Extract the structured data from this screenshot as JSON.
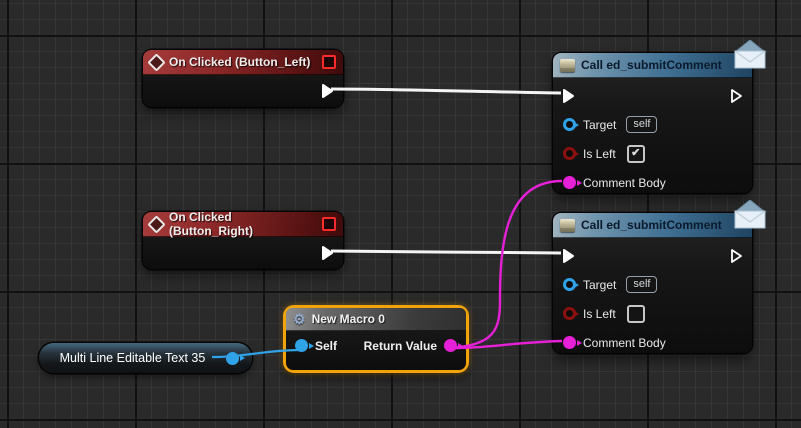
{
  "nodes": {
    "event_left": {
      "title": "On Clicked (Button_Left)"
    },
    "event_right": {
      "title": "On Clicked (Button_Right)"
    },
    "call_top": {
      "title": "Call ed_submitComment",
      "target_label": "Target",
      "target_value": "self",
      "is_left_label": "Is Left",
      "is_left_checked": true,
      "is_left_check_glyph": "✔",
      "comment_label": "Comment Body"
    },
    "call_bottom": {
      "title": "Call ed_submitComment",
      "target_label": "Target",
      "target_value": "self",
      "is_left_label": "Is Left",
      "is_left_checked": false,
      "is_left_check_glyph": "",
      "comment_label": "Comment Body"
    },
    "macro": {
      "title": "New Macro 0",
      "self_label": "Self",
      "return_label": "Return Value",
      "gear_glyph": "⚙"
    },
    "variable": {
      "title": "Multi Line Editable Text 35"
    }
  },
  "colors": {
    "exec_wire": "#f5f5f5",
    "data_wire_magenta": "#e620d6",
    "data_wire_blue": "#2fa2e8",
    "selection_border": "#f0a30a",
    "event_header": "#8a2727",
    "function_header": "#3f6f93",
    "bool_pin": "#8d1010",
    "object_pin": "#2fa2e8",
    "string_pin": "#e620d6"
  }
}
